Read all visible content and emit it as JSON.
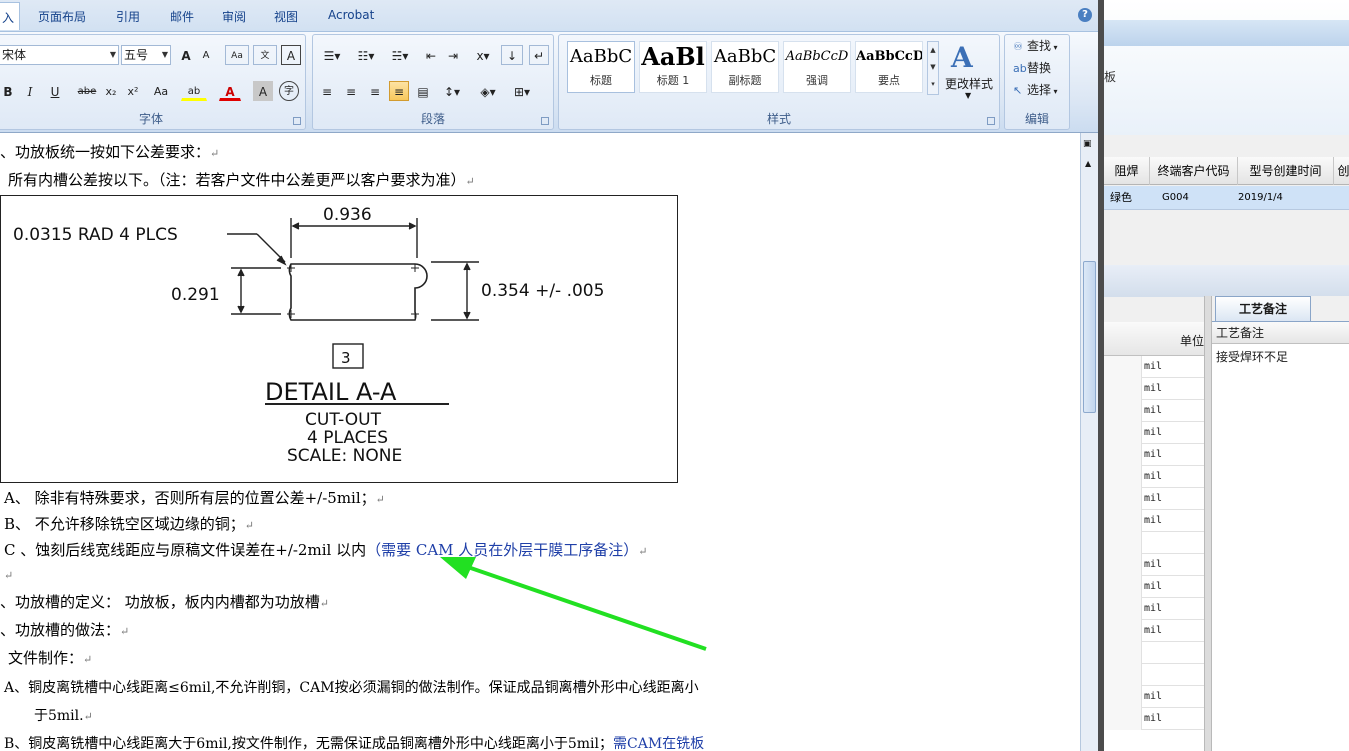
{
  "word": {
    "tabs": [
      "入",
      "页面布局",
      "引用",
      "邮件",
      "审阅",
      "视图",
      "Acrobat"
    ],
    "help": "?",
    "font_group": {
      "label": "字体",
      "font_name": "宋体",
      "font_size": "五号",
      "grow": "A",
      "shrink": "A",
      "bold": "B",
      "italic": "I",
      "underline": "U",
      "strike": "abe",
      "subscript": "x₂",
      "superscript": "x²",
      "case": "Aa",
      "highlight": "ab",
      "font_color": "A",
      "char_shade": "A",
      "enclose": "字"
    },
    "paragraph_group": {
      "label": "段落"
    },
    "styles_group": {
      "label": "样式",
      "styles": [
        {
          "preview": "AaBbC",
          "name": "标题"
        },
        {
          "preview": "AaBl",
          "name": "标题 1"
        },
        {
          "preview": "AaBbC",
          "name": "副标题"
        },
        {
          "preview": "AaBbCcD",
          "name": "强调"
        },
        {
          "preview": "AaBbCcD",
          "name": "要点"
        }
      ],
      "change_styles": "更改样式"
    },
    "editing_group": {
      "label": "编辑",
      "find": "查找",
      "replace": "替换",
      "select": "选择"
    },
    "document": {
      "lines": [
        "、功放板统一按如下公差要求：",
        "所有内槽公差按以下。（注：若客户文件中公差更严以客户要求为准）",
        "A、 除非有特殊要求，否则所有层的位置公差+/-5mil；",
        "B、 不允许移除铣空区域边缘的铜；",
        "C 、蚀刻后线宽线距应与原稿文件误差在+/-2mil 以内",
        "（需要 CAM 人员在外层干膜工序备注）",
        "、功放槽的定义： 功放板，板内内槽都为功放槽",
        "、功放槽的做法：",
        "文件制作：",
        "A、铜皮离铣槽中心线距离≤6mil,不允许削铜，CAM按必须漏铜的做法制作。保证成品铜离槽外形中心线距离小",
        "于5mil.",
        "B、铜皮离铣槽中心线距离大于6mil,按文件制作，无需保证成品铜离槽外形中心线距离小于5mil；",
        "需CAM在铣板"
      ],
      "paragraph_mark": "↵",
      "figure": {
        "rad": "0.0315 RAD 4 PLCS",
        "width_dim": "0.936",
        "height_dim": "0.291",
        "slot_dim": "0.354 +/- .005",
        "detail_no": "3",
        "detail_title": "DETAIL A-A",
        "cut_out": "CUT-OUT",
        "places": "4 PLACES",
        "scale": "SCALE: NONE"
      }
    }
  },
  "app": {
    "top_text": "板",
    "columns": [
      "阻焊",
      "终端客户代码",
      "型号创建时间",
      "创"
    ],
    "row": {
      "solder_mask": "绿色",
      "customer_code": "G004",
      "created": "2019/1/4"
    },
    "left_grid_header": "单位",
    "unit_rows": [
      "mil",
      "mil",
      "mil",
      "mil",
      "mil",
      "mil",
      "mil",
      "mil",
      "",
      "mil",
      "mil",
      "mil",
      "mil",
      "",
      "",
      "mil",
      "mil"
    ],
    "note_tab": "工艺备注",
    "note_header": "工艺备注",
    "note_value": "接受焊环不足"
  },
  "colors": {
    "arrow": "#22e022",
    "blue_text": "#1f3fa8",
    "ribbon": "#dbe6f4"
  }
}
